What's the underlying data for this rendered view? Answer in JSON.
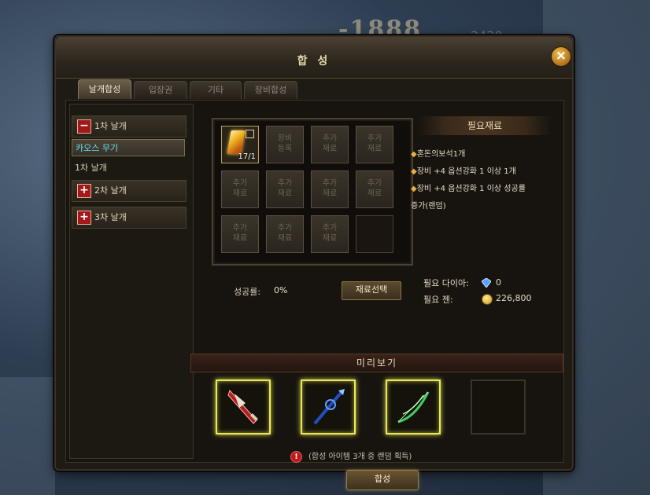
{
  "background": {
    "damage_text": "-1888",
    "damage_text_2": "2420"
  },
  "window": {
    "title": "합 성",
    "close_glyph": "×"
  },
  "tabs": [
    {
      "label": "날개합성",
      "active": true
    },
    {
      "label": "입장권",
      "active": false
    },
    {
      "label": "기타",
      "active": false
    },
    {
      "label": "장비합성",
      "active": false
    }
  ],
  "category_list": {
    "items": [
      {
        "type": "category",
        "toggle": "−",
        "label": "1차 날개",
        "expanded": true
      },
      {
        "type": "sub",
        "label": "카오스 무기",
        "selected": true
      },
      {
        "type": "sub",
        "label": "1차 날개",
        "selected": false
      },
      {
        "type": "category",
        "toggle": "+",
        "label": "2차 날개",
        "expanded": false
      },
      {
        "type": "category",
        "toggle": "+",
        "label": "3차 날개",
        "expanded": false
      }
    ]
  },
  "material_slots": {
    "filled_item": {
      "count": "17/1",
      "lock_glyph": "🔒"
    },
    "slots": [
      {
        "kind": "filled"
      },
      {
        "kind": "label",
        "line1": "장비",
        "line2": "등록"
      },
      {
        "kind": "label",
        "line1": "추가",
        "line2": "재료"
      },
      {
        "kind": "label",
        "line1": "추가",
        "line2": "재료"
      },
      {
        "kind": "label",
        "line1": "추가",
        "line2": "재료"
      },
      {
        "kind": "label",
        "line1": "추가",
        "line2": "재료"
      },
      {
        "kind": "label",
        "line1": "추가",
        "line2": "재료"
      },
      {
        "kind": "label",
        "line1": "추가",
        "line2": "재료"
      },
      {
        "kind": "label",
        "line1": "추가",
        "line2": "재료"
      },
      {
        "kind": "label",
        "line1": "추가",
        "line2": "재료"
      },
      {
        "kind": "label",
        "line1": "추가",
        "line2": "재료"
      },
      {
        "kind": "empty"
      }
    ]
  },
  "requirements": {
    "title": "필요재료",
    "bullet": "◆",
    "lines": [
      "혼돈의보석1개",
      "장비 +4 옵션강화 1 이상 1개",
      "장비 +4 옵션강화 1 이상 성공률",
      "증가(랜덤)"
    ]
  },
  "success_rate": {
    "label": "성공률:",
    "value": "0%"
  },
  "select_button": "재료선택",
  "costs": {
    "diamond_label": "필요 다이아:",
    "diamond_value": "0",
    "zen_label": "필요 젠:",
    "zen_value": "226,800"
  },
  "preview": {
    "title": "미리보기",
    "items": [
      {
        "name": "red-blade-icon",
        "color": "#c03030",
        "glow": true
      },
      {
        "name": "blue-staff-icon",
        "color": "#3070e0",
        "glow": true
      },
      {
        "name": "green-bow-icon",
        "color": "#40d060",
        "glow": true
      },
      {
        "name": "empty-slot",
        "glow": false
      }
    ]
  },
  "notice": "(합성 아이템 3개 중 랜덤 획득)",
  "craft_button": "합성"
}
